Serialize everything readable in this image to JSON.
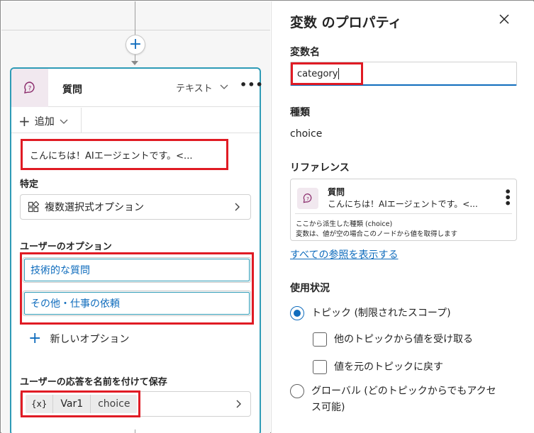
{
  "canvas": {
    "node": {
      "title": "質問",
      "type_label": "テキスト",
      "more": "•••",
      "add_label": "追加",
      "message": "こんにちは！AIエージェントです。<...",
      "identify_label": "特定",
      "identify_value": "複数選択式オプション",
      "options_label": "ユーザーのオプション",
      "options": [
        "技術的な質問",
        "その他・仕事の依頼"
      ],
      "new_option_label": "新しいオプション",
      "save_label": "ユーザーの応答を名前を付けて保存",
      "variable": {
        "icon_text": "{x}",
        "name": "Var1",
        "type": "choice"
      }
    }
  },
  "panel": {
    "title": "変数 のプロパティ",
    "name_label": "変数名",
    "name_value": "category",
    "kind_label": "種類",
    "kind_value": "choice",
    "reference_label": "リファレンス",
    "reference": {
      "title": "質問",
      "subtitle": "こんにちは！AIエージェントです。<...",
      "note1": "ここから派生した種類 (choice)",
      "note2": "変数は、値が空の場合このノードから値を取得します"
    },
    "show_all_refs": "すべての参照を表示する",
    "usage_label": "使用状況",
    "usage": {
      "topic": "トピック (制限されたスコープ)",
      "receive": "他のトピックから値を受け取る",
      "return": "値を元のトピックに戻す",
      "global_line1": "グローバル (どのトピックからでもアクセ",
      "global_line2": "ス可能)"
    }
  },
  "colors": {
    "accent": "#0f6cbd",
    "node_border": "#2e9bb6",
    "highlight": "#e01b24",
    "icon_bg": "#f1e8ef"
  }
}
